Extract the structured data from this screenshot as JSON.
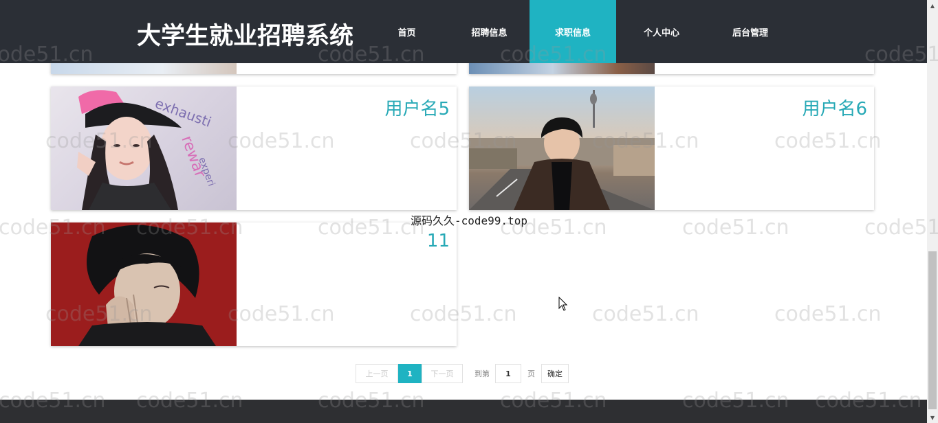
{
  "header": {
    "site_title": "大学生就业招聘系统",
    "nav": [
      {
        "label": "首页",
        "active": false
      },
      {
        "label": "招聘信息",
        "active": false
      },
      {
        "label": "求职信息",
        "active": true
      },
      {
        "label": "个人中心",
        "active": false
      },
      {
        "label": "后台管理",
        "active": false
      }
    ]
  },
  "cards": [
    {
      "name": "用户名5"
    },
    {
      "name": "用户名6"
    },
    {
      "name": "11"
    }
  ],
  "pagination": {
    "prev_label": "上一页",
    "current_page": "1",
    "next_label": "下一页",
    "goto_prefix": "到第",
    "goto_value": "1",
    "goto_suffix": "页",
    "confirm_label": "确定"
  },
  "watermark": {
    "text": "code51.cn",
    "center_text": "源码久久-code99.top"
  },
  "colors": {
    "accent": "#1fb3c2",
    "header_bg": "#2b2f36",
    "name_text": "#27a9b6"
  }
}
